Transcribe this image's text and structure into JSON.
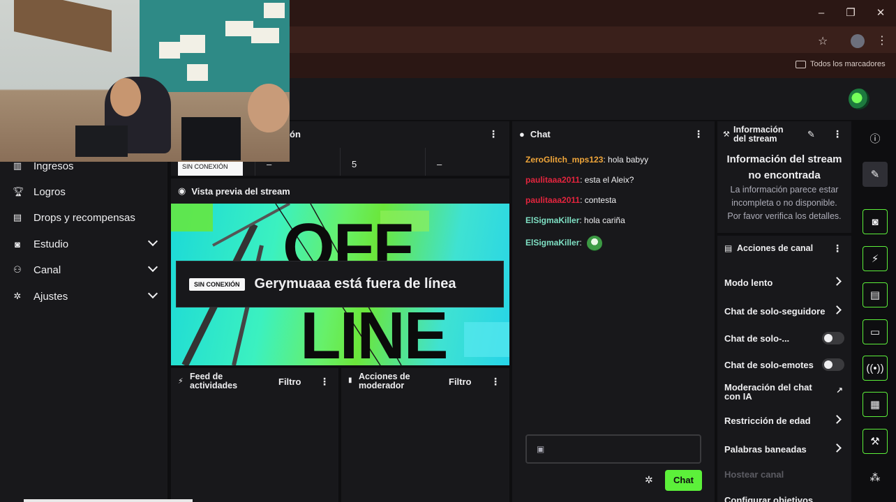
{
  "browser": {
    "bookmarks_folder": "Todos los marcadores",
    "icons": [
      "minimize-icon",
      "restore-icon",
      "close-icon",
      "star-icon",
      "kebab-icon"
    ]
  },
  "nav": {
    "items": [
      {
        "label": "Ingresos",
        "icon": "revenue-icon"
      },
      {
        "label": "Logros",
        "icon": "trophy-icon"
      },
      {
        "label": "Drops y recompensas",
        "icon": "drops-icon"
      },
      {
        "label": "Estudio",
        "icon": "studio-icon"
      },
      {
        "label": "Canal",
        "icon": "channel-icon"
      },
      {
        "label": "Ajustes",
        "icon": "settings-icon"
      }
    ]
  },
  "stats": {
    "header_partial": "ón",
    "status_tag": "SIN CONEXIÓN",
    "cells": [
      "–",
      "5",
      "–"
    ]
  },
  "preview": {
    "title": "Vista previa del stream",
    "pill": "SIN CONEXIÓN",
    "offline_message": "Gerymuaaa está fuera de línea",
    "bg_word_1": "OFF",
    "bg_word_2": "LINE"
  },
  "activity": {
    "title": "Feed de actividades",
    "filter": "Filtro"
  },
  "mod_actions": {
    "title": "Acciones de moderador",
    "filter": "Filtro"
  },
  "chat": {
    "title": "Chat",
    "messages": [
      {
        "user": "ZeroGlitch_mps123",
        "text": ": hola babyy",
        "color": "#f0a63a"
      },
      {
        "user": "paulitaaa2011",
        "text": ": esta el Aleix?",
        "color": "#e3253e"
      },
      {
        "user": "paulitaaa2011",
        "text": ": contesta",
        "color": "#e3253e"
      },
      {
        "user": "ElSigmaKiller",
        "text": ": hola cariña",
        "color": "#7fe0c4"
      },
      {
        "user": "ElSigmaKiller",
        "text": ":",
        "color": "#7fe0c4"
      }
    ],
    "send_label": "Chat",
    "accent": "#5cf03a"
  },
  "stream_info": {
    "title": "Información del stream",
    "heading": "Información del stream no encontrada",
    "desc": "La información parece estar incompleta o no disponible. Por favor verifica los detalles."
  },
  "channel_actions": {
    "title": "Acciones de canal",
    "items": [
      {
        "label": "Modo lento",
        "control": "chevron"
      },
      {
        "label": "Chat de solo-seguidore",
        "control": "chevron"
      },
      {
        "label": "Chat de solo-...",
        "control": "toggle",
        "on": false
      },
      {
        "label": "Chat de solo-emotes",
        "control": "toggle",
        "on": false
      },
      {
        "label": "Moderación del chat con IA",
        "control": "external"
      },
      {
        "label": "Restricción de edad",
        "control": "chevron"
      },
      {
        "label": "Palabras baneadas",
        "control": "chevron"
      },
      {
        "label": "Hostear canal",
        "control": "none"
      },
      {
        "label": "Configurar objetivos",
        "control": "chevron"
      }
    ]
  }
}
